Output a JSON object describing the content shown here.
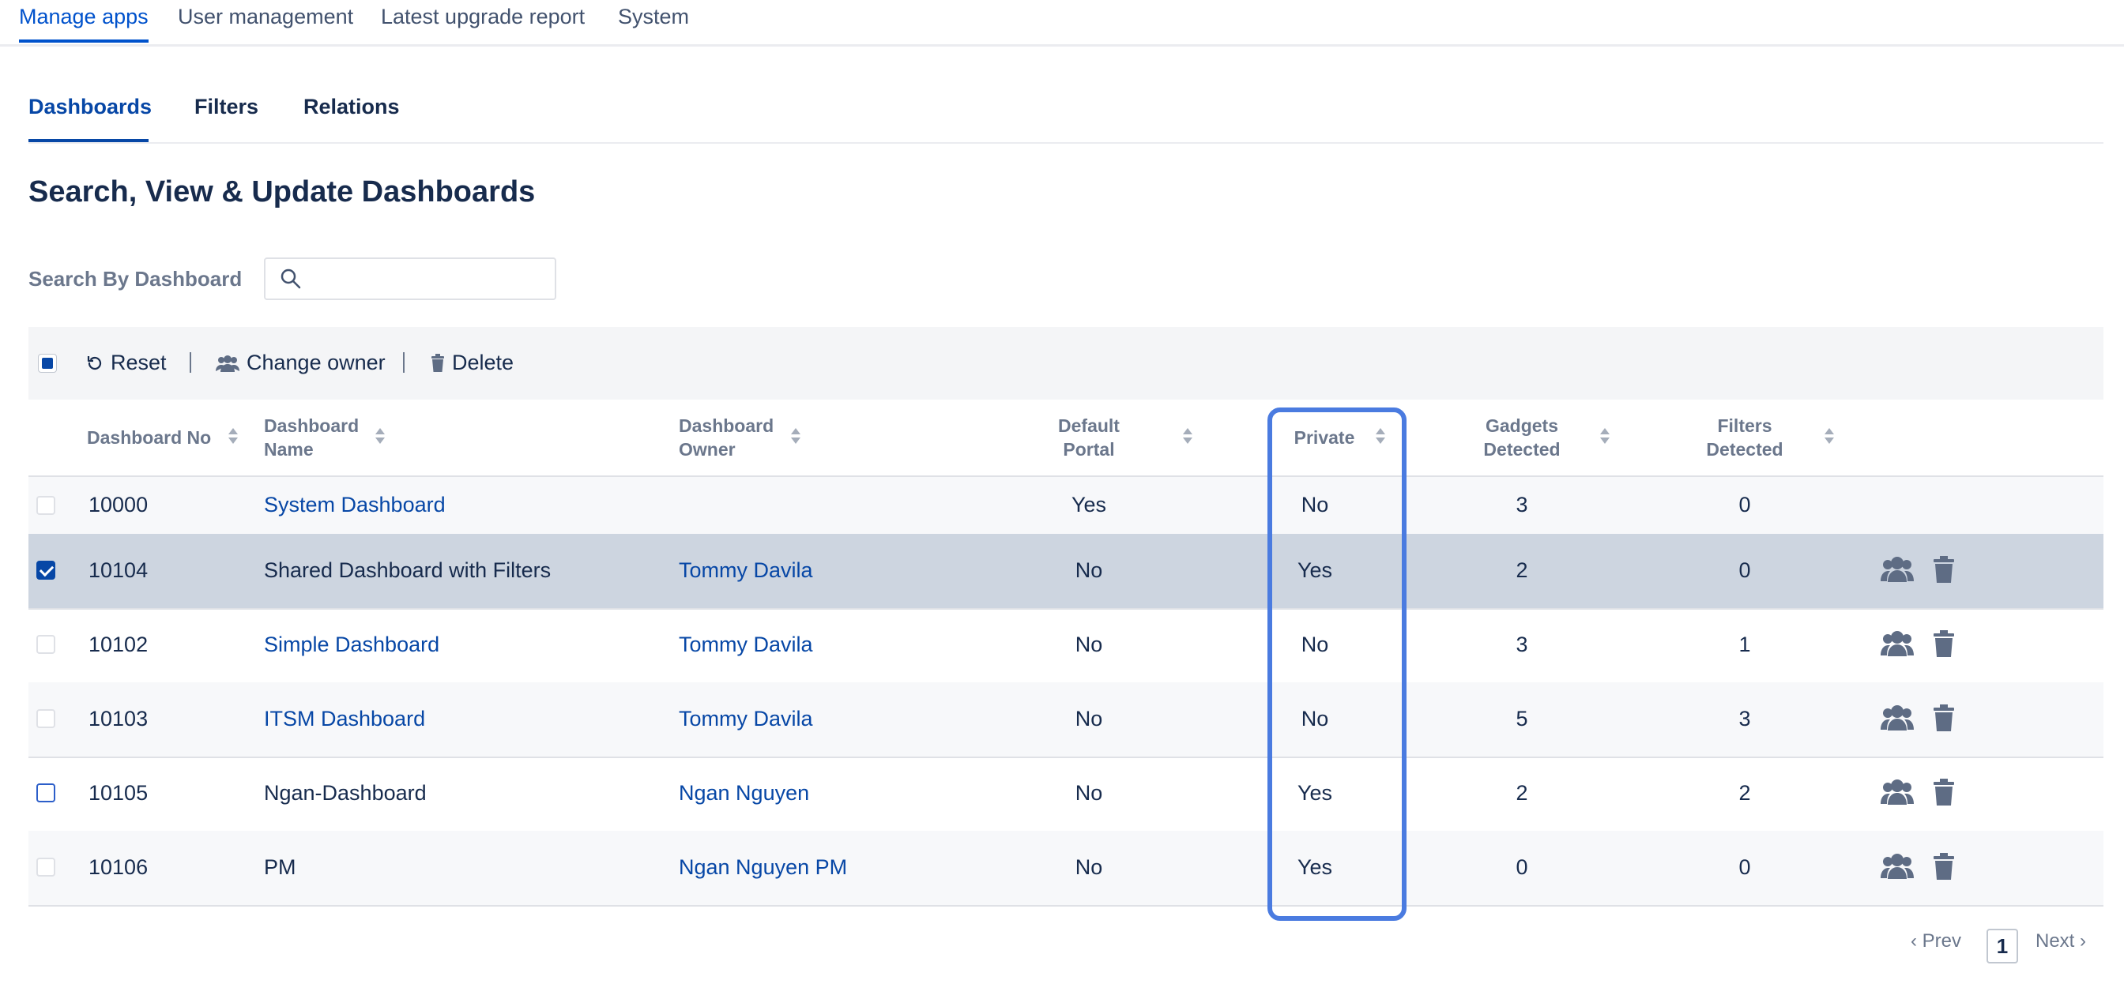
{
  "topnav": {
    "items": [
      "Manage apps",
      "User management",
      "Latest upgrade report",
      "System"
    ]
  },
  "subtabs": [
    "Dashboards",
    "Filters",
    "Relations"
  ],
  "page_title": "Search, View & Update Dashboards",
  "search": {
    "label": "Search By Dashboard",
    "value": "",
    "placeholder": ""
  },
  "toolbar": {
    "reset": "Reset",
    "change_owner": "Change owner",
    "delete": "Delete"
  },
  "columns": {
    "no": "Dashboard No",
    "name": [
      "Dashboard",
      "Name"
    ],
    "owner": [
      "Dashboard",
      "Owner"
    ],
    "portal": [
      "Default",
      "Portal"
    ],
    "private": "Private",
    "gadgets": [
      "Gadgets",
      "Detected"
    ],
    "filters": [
      "Filters",
      "Detected"
    ]
  },
  "rows": [
    {
      "no": "10000",
      "name": "System Dashboard",
      "owner": "",
      "portal": "Yes",
      "private": "No",
      "gadgets": "3",
      "filters": "0"
    },
    {
      "no": "10104",
      "name": "Shared Dashboard with Filters",
      "owner": "Tommy Davila",
      "portal": "No",
      "private": "Yes",
      "gadgets": "2",
      "filters": "0"
    },
    {
      "no": "10102",
      "name": "Simple Dashboard",
      "owner": "Tommy Davila",
      "portal": "No",
      "private": "No",
      "gadgets": "3",
      "filters": "1"
    },
    {
      "no": "10103",
      "name": "ITSM Dashboard",
      "owner": "Tommy Davila",
      "portal": "No",
      "private": "No",
      "gadgets": "5",
      "filters": "3"
    },
    {
      "no": "10105",
      "name": "Ngan-Dashboard",
      "owner": "Ngan Nguyen",
      "portal": "No",
      "private": "Yes",
      "gadgets": "2",
      "filters": "2"
    },
    {
      "no": "10106",
      "name": "PM",
      "owner": "Ngan Nguyen PM",
      "portal": "No",
      "private": "Yes",
      "gadgets": "0",
      "filters": "0"
    }
  ],
  "pagination": {
    "prev": "Prev",
    "page": "1",
    "next": "Next"
  },
  "colors": {
    "accent": "#0052cc",
    "link": "#0747a6",
    "highlight": "#4a7be0",
    "selected_row": "#cdd5e0"
  }
}
